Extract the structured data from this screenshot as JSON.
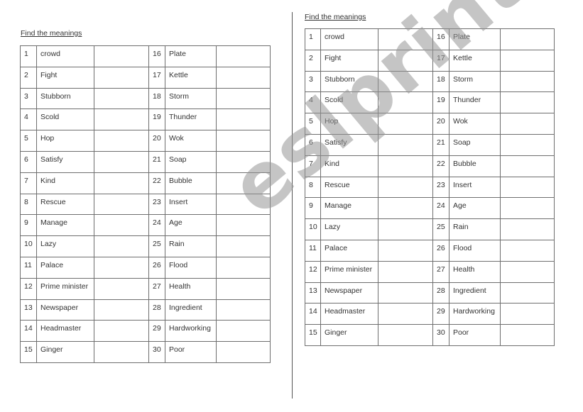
{
  "worksheets": [
    {
      "title": "Find the meanings",
      "rows": [
        {
          "l_num": "1",
          "l_word": "crowd",
          "r_num": "16",
          "r_word": "Plate"
        },
        {
          "l_num": "2",
          "l_word": "Fight",
          "r_num": "17",
          "r_word": "Kettle"
        },
        {
          "l_num": "3",
          "l_word": "Stubborn",
          "r_num": "18",
          "r_word": "Storm"
        },
        {
          "l_num": "4",
          "l_word": "Scold",
          "r_num": "19",
          "r_word": "Thunder"
        },
        {
          "l_num": "5",
          "l_word": "Hop",
          "r_num": "20",
          "r_word": "Wok"
        },
        {
          "l_num": "6",
          "l_word": "Satisfy",
          "r_num": "21",
          "r_word": "Soap"
        },
        {
          "l_num": "7",
          "l_word": "Kind",
          "r_num": "22",
          "r_word": "Bubble"
        },
        {
          "l_num": "8",
          "l_word": "Rescue",
          "r_num": "23",
          "r_word": "Insert"
        },
        {
          "l_num": "9",
          "l_word": "Manage",
          "r_num": "24",
          "r_word": "Age"
        },
        {
          "l_num": "10",
          "l_word": "Lazy",
          "r_num": "25",
          "r_word": "Rain"
        },
        {
          "l_num": "11",
          "l_word": "Palace",
          "r_num": "26",
          "r_word": "Flood"
        },
        {
          "l_num": "12",
          "l_word": "Prime minister",
          "r_num": "27",
          "r_word": "Health"
        },
        {
          "l_num": "13",
          "l_word": "Newspaper",
          "r_num": "28",
          "r_word": "Ingredient"
        },
        {
          "l_num": "14",
          "l_word": "Headmaster",
          "r_num": "29",
          "r_word": "Hardworking"
        },
        {
          "l_num": "15",
          "l_word": "Ginger",
          "r_num": "30",
          "r_word": "Poor"
        }
      ]
    },
    {
      "title": "Find the meanings",
      "rows": [
        {
          "l_num": "1",
          "l_word": "crowd",
          "r_num": "16",
          "r_word": "Plate"
        },
        {
          "l_num": "2",
          "l_word": "Fight",
          "r_num": "17",
          "r_word": "Kettle"
        },
        {
          "l_num": "3",
          "l_word": "Stubborn",
          "r_num": "18",
          "r_word": "Storm"
        },
        {
          "l_num": "4",
          "l_word": "Scold",
          "r_num": "19",
          "r_word": "Thunder"
        },
        {
          "l_num": "5",
          "l_word": "Hop",
          "r_num": "20",
          "r_word": "Wok"
        },
        {
          "l_num": "6",
          "l_word": "Satisfy",
          "r_num": "21",
          "r_word": "Soap"
        },
        {
          "l_num": "7",
          "l_word": "Kind",
          "r_num": "22",
          "r_word": "Bubble"
        },
        {
          "l_num": "8",
          "l_word": "Rescue",
          "r_num": "23",
          "r_word": "Insert"
        },
        {
          "l_num": "9",
          "l_word": "Manage",
          "r_num": "24",
          "r_word": "Age"
        },
        {
          "l_num": "10",
          "l_word": "Lazy",
          "r_num": "25",
          "r_word": "Rain"
        },
        {
          "l_num": "11",
          "l_word": "Palace",
          "r_num": "26",
          "r_word": "Flood"
        },
        {
          "l_num": "12",
          "l_word": "Prime minister",
          "r_num": "27",
          "r_word": "Health"
        },
        {
          "l_num": "13",
          "l_word": "Newspaper",
          "r_num": "28",
          "r_word": "Ingredient"
        },
        {
          "l_num": "14",
          "l_word": "Headmaster",
          "r_num": "29",
          "r_word": "Hardworking"
        },
        {
          "l_num": "15",
          "l_word": "Ginger",
          "r_num": "30",
          "r_word": "Poor"
        }
      ]
    }
  ],
  "watermark": "eslprintables.com"
}
